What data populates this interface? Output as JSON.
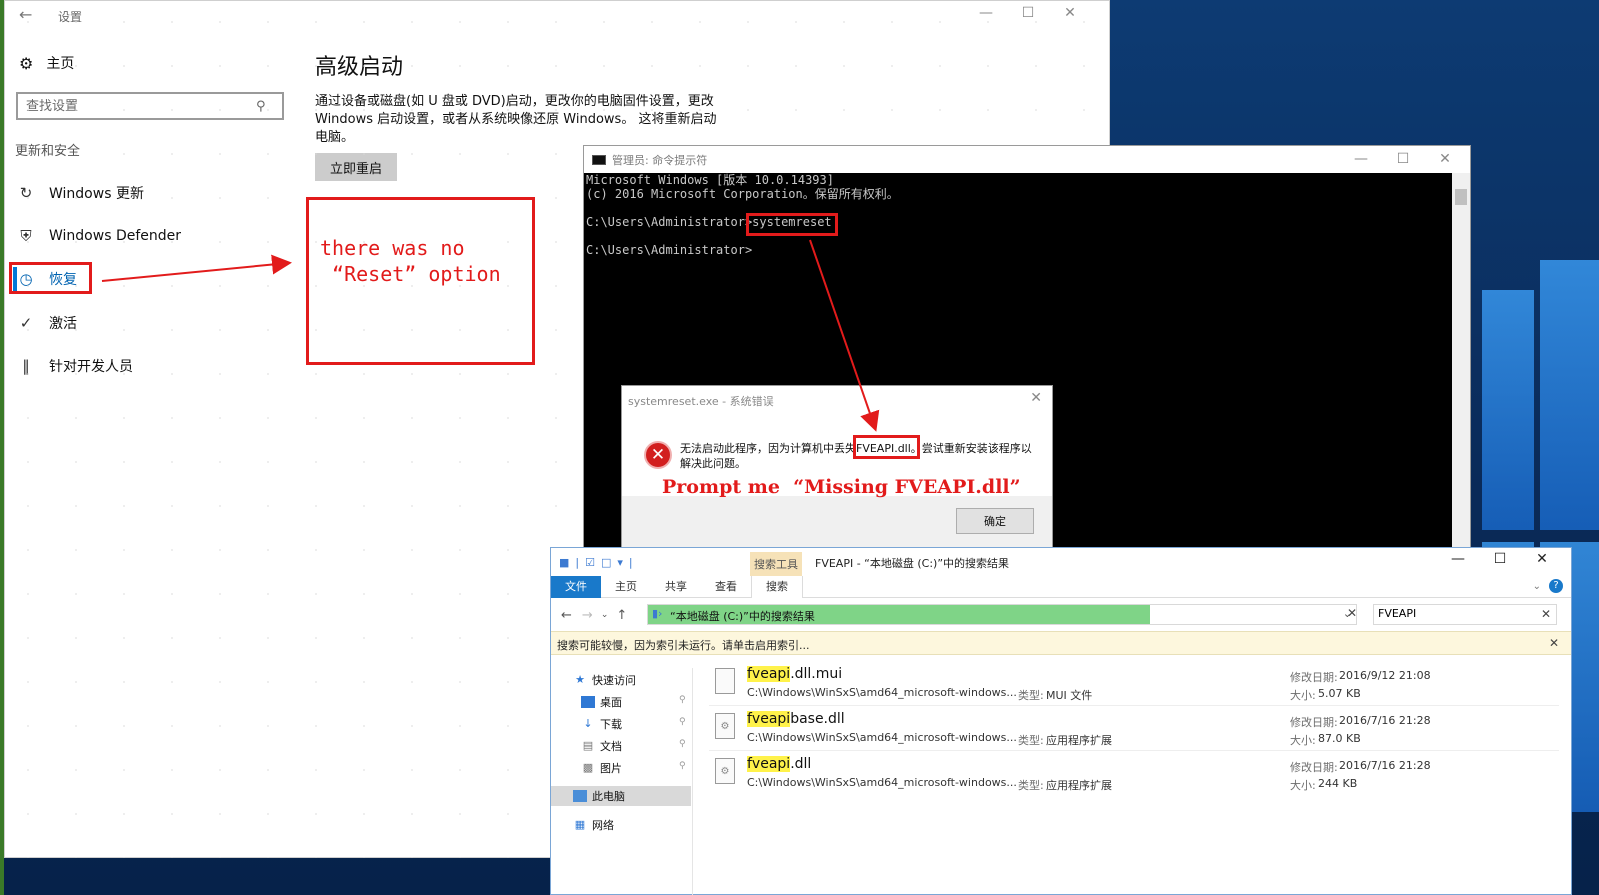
{
  "settings": {
    "title": "设置",
    "home": "主页",
    "search_placeholder": "查找设置",
    "section": "更新和安全",
    "items": [
      {
        "label": "Windows 更新"
      },
      {
        "label": "Windows Defender"
      },
      {
        "label": "恢复"
      },
      {
        "label": "激活"
      },
      {
        "label": "针对开发人员"
      }
    ],
    "advanced_title": "高级启动",
    "advanced_desc": "通过设备或磁盘(如 U 盘或 DVD)启动，更改你的电脑固件设置，更改 Windows 启动设置，或者从系统映像还原 Windows。 这将重新启动电脑。",
    "restart_button": "立即重启"
  },
  "annotations": {
    "no_reset_note": "there was no\n “Reset” option",
    "prompt_note": "Prompt me  “Missing FVEAPI.dll”",
    "accent": "#e21b1b"
  },
  "cmd": {
    "title": "管理员: 命令提示符",
    "lines": [
      "Microsoft Windows [版本 10.0.14393]",
      "(c) 2016 Microsoft Corporation。保留所有权利。",
      "",
      "C:\\Users\\Administrator>systemreset",
      "",
      "C:\\Users\\Administrator>"
    ],
    "prompt": "C:\\Users\\Administrator>",
    "command": "systemreset"
  },
  "error_dialog": {
    "title": "systemreset.exe - 系统错误",
    "message_before": "无法启动此程序，因为计算机中丢失",
    "message_highlight": "FVEAPI.dll。",
    "message_after": "尝试重新安装该程序以解决此问题。",
    "ok_button": "确定"
  },
  "explorer": {
    "title": "FVEAPI - “本地磁盘 (C:)”中的搜索结果",
    "search_tools_tab": "搜索工具",
    "ribbon_tabs": [
      "文件",
      "主页",
      "共享",
      "查看",
      "搜索"
    ],
    "address": "“本地磁盘 (C:)”中的搜索结果",
    "search_value": "FVEAPI",
    "info_bar": "搜索可能较慢，因为索引未运行。请单击启用索引...",
    "sidebar": [
      {
        "label": "快速访问"
      },
      {
        "label": "桌面"
      },
      {
        "label": "下载"
      },
      {
        "label": "文档"
      },
      {
        "label": "图片"
      },
      {
        "label": "此电脑"
      },
      {
        "label": "网络"
      }
    ],
    "labels": {
      "modified": "修改日期:",
      "size": "大小:",
      "type": "类型:"
    },
    "files": [
      {
        "name_hl": "fveapi",
        "name_rest": ".dll.mui",
        "path": "C:\\Windows\\WinSxS\\amd64_microsoft-windows...",
        "type": "MUI 文件",
        "modified": "2016/9/12 21:08",
        "size": "5.07 KB"
      },
      {
        "name_hl": "fveapi",
        "name_rest": "base.dll",
        "path": "C:\\Windows\\WinSxS\\amd64_microsoft-windows...",
        "type": "应用程序扩展",
        "modified": "2016/7/16 21:28",
        "size": "87.0 KB"
      },
      {
        "name_hl": "fveapi",
        "name_rest": ".dll",
        "path": "C:\\Windows\\WinSxS\\amd64_microsoft-windows...",
        "type": "应用程序扩展",
        "modified": "2016/7/16 21:28",
        "size": "244 KB"
      }
    ]
  }
}
